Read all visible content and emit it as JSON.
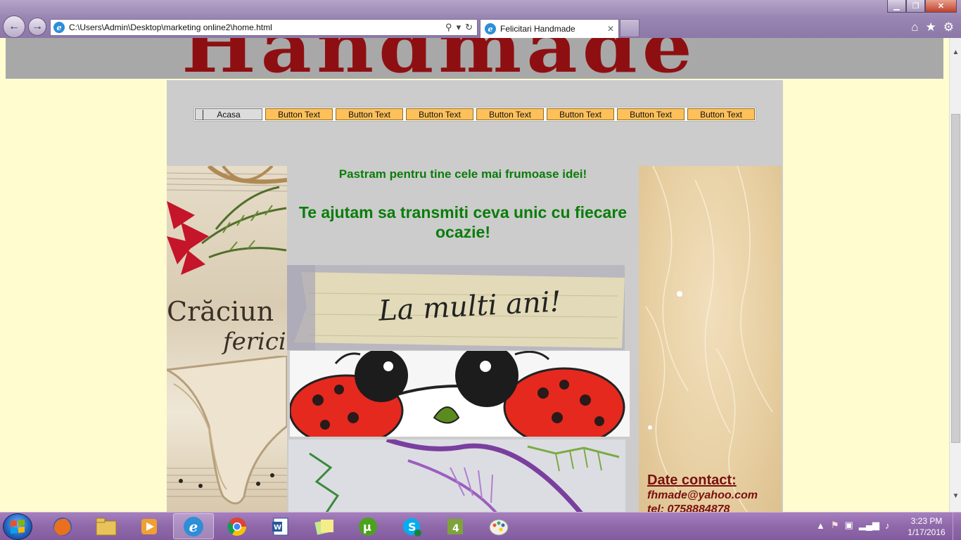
{
  "browser": {
    "address_url": "C:\\Users\\Admin\\Desktop\\marketing online2\\home.html",
    "tab_title": "Felicitari Handmade"
  },
  "page": {
    "logo_text": "Handmade",
    "menu": [
      "Acasa",
      "Button Text",
      "Button Text",
      "Button Text",
      "Button Text",
      "Button Text",
      "Button Text",
      "Button Text"
    ],
    "tagline_small": "Pastram pentru tine cele mai frumoase idei!",
    "tagline_large": "Te ajutam sa transmiti ceva unic cu fiecare ocazie!",
    "left_image_text1": "Crăciun",
    "left_image_text2": "fericit",
    "note_image_text": "La multi ani!",
    "contact": {
      "title": "Date contact:",
      "email": "fhmade@yahoo.com",
      "phone": "tel: 0758884878"
    }
  },
  "taskbar": {
    "time": "3:23 PM",
    "date": "1/17/2016"
  },
  "colors": {
    "page_bg": "#fffccf",
    "menu_button": "#ffc05a",
    "logo": "#8e0f12",
    "tagline": "#0a7d0a",
    "contact": "#7a0f0f"
  }
}
